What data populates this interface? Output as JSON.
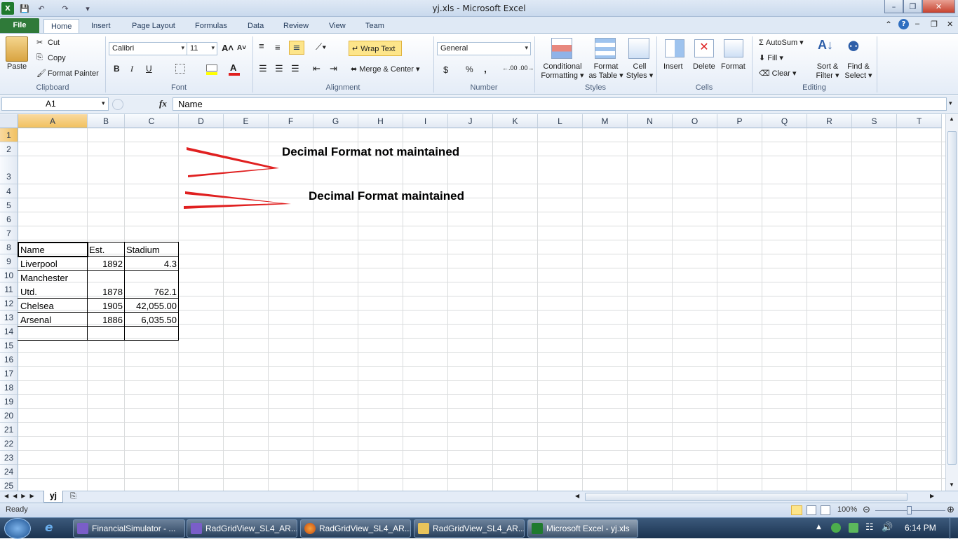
{
  "window": {
    "title": "yj.xls  -  Microsoft Excel"
  },
  "tabs": [
    "File",
    "Home",
    "Insert",
    "Page Layout",
    "Formulas",
    "Data",
    "Review",
    "View",
    "Team"
  ],
  "ribbon": {
    "clipboard": {
      "label": "Clipboard",
      "paste": "Paste",
      "cut": "Cut",
      "copy": "Copy",
      "format_painter": "Format Painter"
    },
    "font": {
      "label": "Font",
      "name": "Calibri",
      "size": "11",
      "bold": "B",
      "italic": "I",
      "underline": "U"
    },
    "alignment": {
      "label": "Alignment",
      "wrap_text": "Wrap Text",
      "merge_center": "Merge & Center"
    },
    "number": {
      "label": "Number",
      "format": "General",
      "currency": "$",
      "percent": "%",
      "comma": ","
    },
    "styles": {
      "label": "Styles",
      "conditional": "Conditional",
      "conditional2": "Formatting",
      "format_table": "Format",
      "format_table2": "as Table",
      "cell_styles": "Cell",
      "cell_styles2": "Styles"
    },
    "cells": {
      "label": "Cells",
      "insert": "Insert",
      "delete": "Delete",
      "format": "Format"
    },
    "editing": {
      "label": "Editing",
      "autosum": "AutoSum",
      "fill": "Fill",
      "clear": "Clear",
      "sort": "Sort &",
      "sort2": "Filter",
      "find": "Find &",
      "find2": "Select"
    }
  },
  "formula_bar": {
    "name_box": "A1",
    "fx": "fx",
    "content": "Name"
  },
  "columns": [
    "A",
    "B",
    "C",
    "D",
    "E",
    "F",
    "G",
    "H",
    "I",
    "J",
    "K",
    "L",
    "M",
    "N",
    "O",
    "P",
    "Q",
    "R",
    "S",
    "T"
  ],
  "rows": [
    "1",
    "2",
    "3",
    "4",
    "5",
    "6",
    "7",
    "8",
    "9",
    "10",
    "11",
    "12",
    "13",
    "14",
    "15",
    "16",
    "17",
    "18",
    "19",
    "20",
    "21",
    "22",
    "23",
    "24",
    "25"
  ],
  "cells": {
    "A1": "Name",
    "B1": "Est.",
    "C1": "Stadium",
    "A2": "Liverpool",
    "B2": "1892",
    "C2": "4.3",
    "A3a": "Manchester",
    "A3b": "Utd.",
    "B3": "1878",
    "C3": "762.1",
    "A4": "Chelsea",
    "B4": "1905",
    "C4": "42,055.00",
    "A5": "Arsenal",
    "B5": "1886",
    "C5": "6,035.50"
  },
  "annotations": {
    "top": "Decimal Format not maintained",
    "bottom": "Decimal Format maintained",
    "arrow_color": "#e02020"
  },
  "sheet_tab": "yj",
  "status": {
    "ready": "Ready",
    "zoom": "100%"
  },
  "taskbar": {
    "items": [
      "FinancialSimulator - ...",
      "RadGridView_SL4_AR...",
      "RadGridView_SL4_AR...",
      "RadGridView_SL4_AR...",
      "Microsoft Excel - yj.xls"
    ],
    "clock": "6:14 PM"
  }
}
